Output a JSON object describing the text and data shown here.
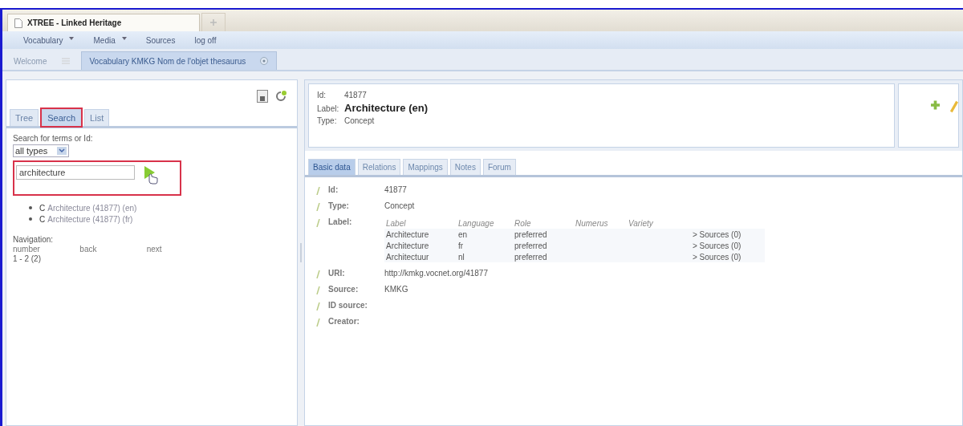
{
  "browser_tabs": [
    {
      "label": "XTREE - Linked Heritage",
      "selected": true
    }
  ],
  "menu": [
    {
      "label": "Vocabulary",
      "dropdown": true
    },
    {
      "label": "Media",
      "dropdown": true
    },
    {
      "label": "Sources",
      "dropdown": false
    },
    {
      "label": "log off",
      "dropdown": false
    }
  ],
  "doc_tabs": [
    {
      "label": "Welcome",
      "selected": false
    },
    {
      "label": "Vocabulary KMKG Nom de l'objet thesaurus",
      "selected": true
    }
  ],
  "left_panel": {
    "tabs": [
      {
        "label": "Tree",
        "selected": false,
        "highlighted": false
      },
      {
        "label": "Search",
        "selected": true,
        "highlighted": true
      },
      {
        "label": "List",
        "selected": false,
        "highlighted": false
      }
    ],
    "search": {
      "prompt": "Search for terms or Id:",
      "type_select": "all types",
      "query": "architecture",
      "highlighted": true
    },
    "results": [
      {
        "type_letter": "C",
        "text": "Architecture (41877) (en)"
      },
      {
        "type_letter": "C",
        "text": "Architecture (41877) (fr)"
      }
    ],
    "navigation": {
      "title": "Navigation:",
      "columns": [
        "number",
        "back",
        "next"
      ],
      "value": "1 - 2 (2)"
    }
  },
  "header": {
    "rows": [
      {
        "label": "Id:",
        "value": "41877",
        "kind": "plain"
      },
      {
        "label": "Label:",
        "value": "Architecture (en)",
        "kind": "title"
      },
      {
        "label": "Type:",
        "value": "Concept",
        "kind": "plain"
      }
    ]
  },
  "detail_tabs": [
    {
      "label": "Basic data",
      "selected": true
    },
    {
      "label": "Relations",
      "selected": false
    },
    {
      "label": "Mappings",
      "selected": false
    },
    {
      "label": "Notes",
      "selected": false
    },
    {
      "label": "Forum",
      "selected": false
    }
  ],
  "fields": [
    {
      "kind": "text",
      "label": "Id:",
      "value": "41877"
    },
    {
      "kind": "text",
      "label": "Type:",
      "value": "Concept"
    },
    {
      "kind": "table",
      "label": "Label:",
      "columns": [
        "Label",
        "Language",
        "Role",
        "Numerus",
        "Variety"
      ],
      "rows": [
        {
          "label": "Architecture",
          "language": "en",
          "role": "preferred",
          "sources": "> Sources (0)"
        },
        {
          "label": "Architecture",
          "language": "fr",
          "role": "preferred",
          "sources": "> Sources (0)"
        },
        {
          "label": "Architectuur",
          "language": "nl",
          "role": "preferred",
          "sources": "> Sources (0)"
        }
      ]
    },
    {
      "kind": "text",
      "label": "URI:",
      "value": "http://kmkg.vocnet.org/41877"
    },
    {
      "kind": "text",
      "label": "Source:",
      "value": "KMKG"
    },
    {
      "kind": "empty",
      "label": "ID source:"
    },
    {
      "kind": "empty",
      "label": "Creator:"
    }
  ]
}
